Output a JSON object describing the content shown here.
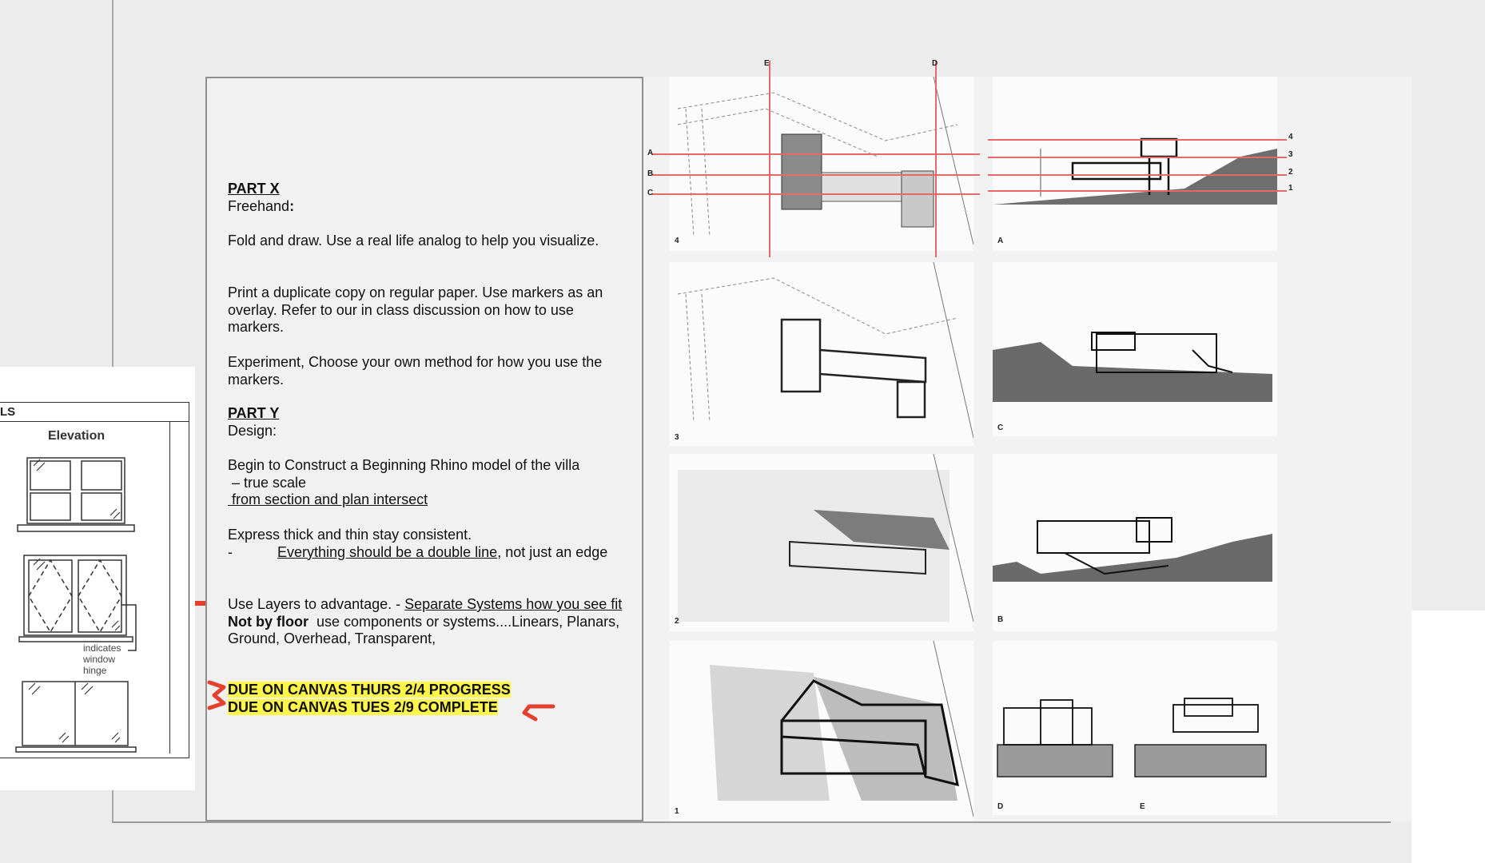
{
  "left_sheet": {
    "header_fragment": "LS",
    "elevation_label": "Elevation",
    "hinge_note": "indicates window hinge"
  },
  "panel": {
    "part_x_title": "PART X",
    "part_x_sub": "Freehand",
    "part_x_colon": ":",
    "para1": "Fold and draw. Use a real life analog to help you visualize.",
    "para2": "Print a duplicate copy on regular paper. Use markers as an overlay. Refer to our in class discussion on how to use markers.",
    "para3": "Experiment, Choose your own method for how you use the markers.",
    "part_y_title": "PART Y",
    "part_y_sub": "Design:",
    "para4_line1": "Begin to Construct a Beginning Rhino model of the villa",
    "para4_line2": " – true scale",
    "para4_line3": " from section and plan intersect",
    "para5_line1": "Express thick and thin stay consistent.",
    "para5_dash": "-",
    "para5_underlined": "Everything should be a double line",
    "para5_rest": ", not just an edge",
    "para6_lead": "Use Layers to advantage. - ",
    "para6_underlined": "Separate Systems how you see fit",
    "para6_bold": "Not by floor",
    "para6_rest": "  use components or systems....Linears, Planars, Ground, Overhead, Transparent,",
    "due1": "DUE ON CANVAS THURS 2/4 PROGRESS",
    "due2": "DUE ON CANVAS TUES 2/9 COMPLETE"
  },
  "drawings": {
    "plans": [
      "4",
      "3",
      "2",
      "1"
    ],
    "sections": [
      "A",
      "C",
      "B"
    ],
    "elevations": [
      "D",
      "E"
    ],
    "section_refs_plan": [
      "A",
      "B",
      "C"
    ],
    "section_refs_top": [
      "E",
      "D"
    ],
    "level_refs": [
      "4",
      "3",
      "2",
      "1"
    ]
  },
  "colors": {
    "highlight": "#fff64a",
    "markup_red": "#e5402e",
    "cut_line": "#e46a6a"
  }
}
